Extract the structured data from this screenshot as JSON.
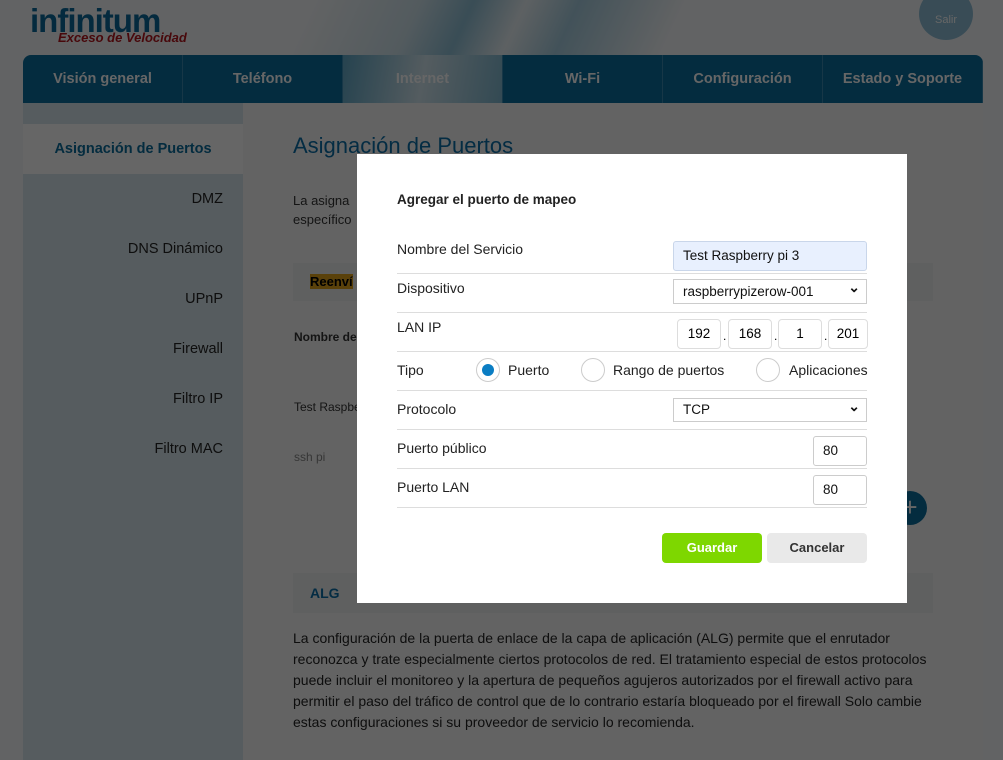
{
  "header": {
    "logo": "infinitum",
    "slogan": "Exceso de Velocidad",
    "logout": "Salir"
  },
  "tabs": [
    "Visión general",
    "Teléfono",
    "Internet",
    "Wi-Fi",
    "Configuración",
    "Estado y Soporte"
  ],
  "active_tab": "Internet",
  "sidebar": [
    "Asignación de Puertos",
    "DMZ",
    "DNS Dinámico",
    "UPnP",
    "Firewall",
    "Filtro IP",
    "Filtro MAC"
  ],
  "page": {
    "title": "Asignación de Puertos",
    "desc_line1": "La asigna",
    "desc_line2": "específico",
    "section": "Reenví",
    "col_header": "Nombre de",
    "rows": [
      "Test Raspbe",
      "ssh pi"
    ],
    "alg_title": "ALG",
    "alg_text": "La configuración de la puerta de enlace de la capa de aplicación (ALG) permite que el enrutador reconozca y trate especialmente ciertos protocolos de red. El tratamiento especial de estos protocolos puede incluir el monitoreo y la apertura de pequeños agujeros autorizados por el firewall activo para permitir el paso del tráfico de control que de lo contrario estaría bloqueado por el firewall Solo cambie estas configuraciones si su proveedor de servicio lo recomienda."
  },
  "modal": {
    "title": "Agregar el puerto de mapeo",
    "service_label": "Nombre del Servicio",
    "service_value": "Test Raspberry pi 3",
    "device_label": "Dispositivo",
    "device_value": "raspberrypizerow-001",
    "lanip_label": "LAN IP",
    "ip": [
      "192",
      "168",
      "1",
      "201"
    ],
    "type_label": "Tipo",
    "type_options": [
      "Puerto",
      "Rango de puertos",
      "Aplicaciones"
    ],
    "type_selected": "Puerto",
    "protocol_label": "Protocolo",
    "protocol_value": "TCP",
    "public_port_label": "Puerto público",
    "public_port": "80",
    "lan_port_label": "Puerto LAN",
    "lan_port": "80",
    "save": "Guardar",
    "cancel": "Cancelar"
  },
  "colors": {
    "accent": "#0a6d9e",
    "save": "#7ed700",
    "overlay": "rgba(0,0,0,0.62)"
  }
}
